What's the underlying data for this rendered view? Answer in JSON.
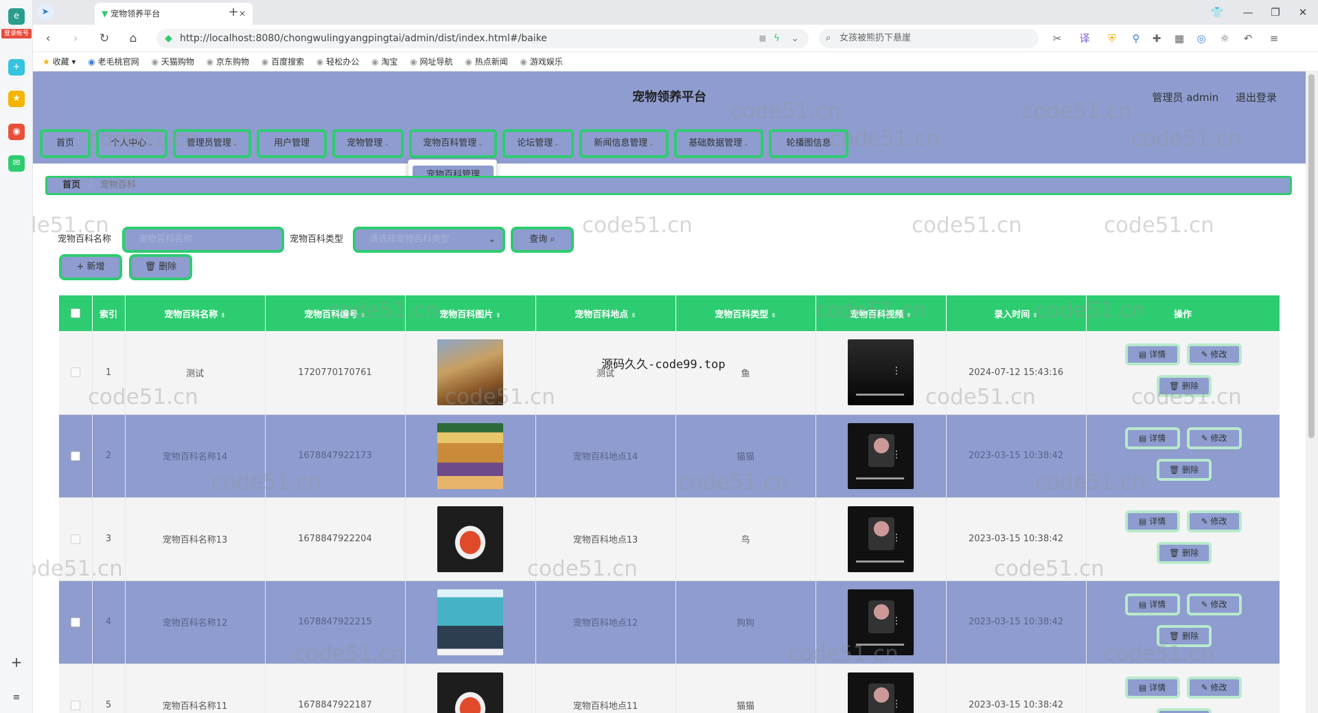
{
  "browser": {
    "tab_title": "宠物领养平台",
    "url": "http://localhost:8080/chongwulingyangpingtai/admin/dist/index.html#/baike",
    "search_placeholder": "女孩被熊扔下悬崖",
    "badge": "登录帐号",
    "bookmarks": [
      "收藏",
      "老毛桃官网",
      "天猫购物",
      "京东购物",
      "百度搜索",
      "轻松办公",
      "淘宝",
      "网址导航",
      "热点新闻",
      "游戏娱乐"
    ]
  },
  "header": {
    "title": "宠物领养平台",
    "user": "管理员 admin",
    "logout": "退出登录"
  },
  "menu": {
    "items": [
      "首页",
      "个人中心",
      "管理员管理",
      "用户管理",
      "宠物管理",
      "宠物百科管理",
      "论坛管理",
      "新闻信息管理",
      "基础数据管理",
      "轮播图信息"
    ],
    "dropdown_item": "宠物百科管理"
  },
  "breadcrumb": {
    "home": "首页",
    "sep": "/",
    "current": "宠物百科"
  },
  "filters": {
    "name_label": "宠物百科名称",
    "name_placeholder": "宠物百科名称",
    "type_label": "宠物百科类型",
    "type_placeholder": "请选择宠物百科类型",
    "query_button": "查询 ⌕"
  },
  "actions": {
    "add": "+ 新增",
    "delete": "🗑 删除"
  },
  "table": {
    "headers": [
      "索引",
      "宠物百科名称",
      "宠物百科编号",
      "宠物百科图片",
      "宠物百科地点",
      "宠物百科类型",
      "宠物百科视频",
      "录入时间",
      "操作"
    ],
    "rows": [
      {
        "index": "1",
        "name": "测试",
        "code": "1720770170761",
        "place": "测试",
        "type": "鱼",
        "time": "2024-07-12 15:43:16"
      },
      {
        "index": "2",
        "name": "宠物百科名称14",
        "code": "1678847922173",
        "place": "宠物百科地点14",
        "type": "猫猫",
        "time": "2023-03-15 10:38:42"
      },
      {
        "index": "3",
        "name": "宠物百科名称13",
        "code": "1678847922204",
        "place": "宠物百科地点13",
        "type": "鸟",
        "time": "2023-03-15 10:38:42"
      },
      {
        "index": "4",
        "name": "宠物百科名称12",
        "code": "1678847922215",
        "place": "宠物百科地点12",
        "type": "狗狗",
        "time": "2023-03-15 10:38:42"
      },
      {
        "index": "5",
        "name": "宠物百科名称11",
        "code": "1678847922187",
        "place": "宠物百科地点11",
        "type": "猫猫",
        "time": "2023-03-15 10:38:42"
      }
    ],
    "op_detail": "▤ 详情",
    "op_edit": "✎ 修改",
    "op_delete": "🗑 删除"
  },
  "overlay_text": "源码久久-code99.top",
  "watermark": "code51.cn",
  "colors": {
    "accent_green": "#2ecc71",
    "header_blue": "#8e9ccf"
  }
}
